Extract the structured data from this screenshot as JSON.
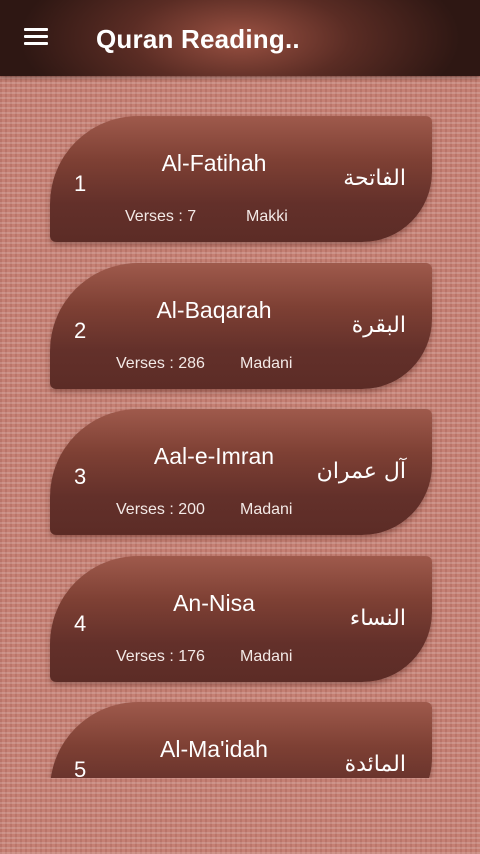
{
  "app_bar": {
    "title": "Quran Reading..",
    "menu_icon": "menu-icon"
  },
  "surahs": [
    {
      "number": "1",
      "name": "Al-Fatihah",
      "arabic": "الفاتحة",
      "verses": "Verses : 7",
      "type": "Makki"
    },
    {
      "number": "2",
      "name": "Al-Baqarah",
      "arabic": "البقرة",
      "verses": "Verses : 286",
      "type": "Madani"
    },
    {
      "number": "3",
      "name": "Aal-e-Imran",
      "arabic": "آل عمران",
      "verses": "Verses : 200",
      "type": "Madani"
    },
    {
      "number": "4",
      "name": "An-Nisa",
      "arabic": "النساء",
      "verses": "Verses : 176",
      "type": "Madani"
    },
    {
      "number": "5",
      "name": "Al-Ma'idah",
      "arabic": "المائدة",
      "verses": "",
      "type": ""
    }
  ],
  "colors": {
    "app_bar": "#5a2c24",
    "card": "#7e4034",
    "background": "#c58074"
  }
}
